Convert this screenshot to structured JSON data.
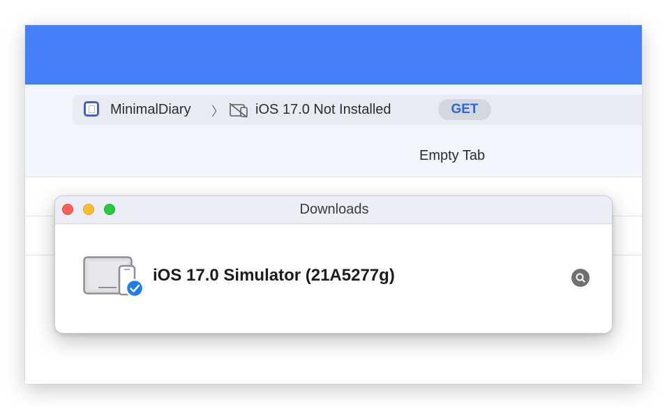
{
  "toolbar": {
    "scheme_name": "MinimalDiary",
    "breadcrumb_separator": "〉",
    "destination_label": "iOS 17.0 Not Installed",
    "get_button_label": "GET",
    "tab_label": "Empty Tab"
  },
  "downloads": {
    "title": "Downloads",
    "items": [
      {
        "title": "iOS 17.0 Simulator (21A5277g)",
        "icon": "simulator-device-icon",
        "status_icon": "checkmark-badge-icon",
        "action_icon": "magnifier-icon"
      }
    ]
  },
  "colors": {
    "titlebar": "#4680fb",
    "toolbar_bg": "#f4f6fd",
    "accent": "#2a67d8",
    "check_badge": "#1e7cf2",
    "traffic_close": "#ff5f57",
    "traffic_minimize": "#febc2e",
    "traffic_zoom": "#28c840"
  }
}
